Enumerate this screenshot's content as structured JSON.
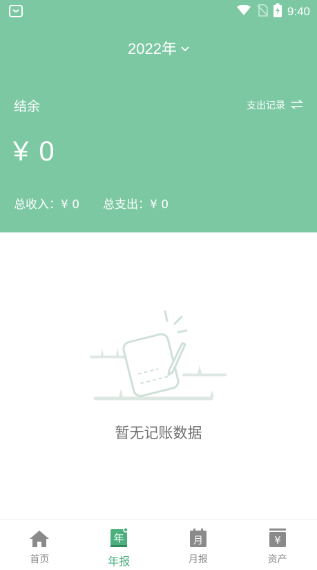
{
  "status_bar": {
    "time": "9:40"
  },
  "header": {
    "year_label": "2022年",
    "balance_label": "结余",
    "records_link_label": "支出记录",
    "balance_amount": "¥ 0",
    "total_income": "总收入：¥ 0",
    "total_expense": "总支出：¥ 0"
  },
  "empty_state": {
    "message": "暂无记账数据"
  },
  "bottom_nav": {
    "items": [
      {
        "label": "首页",
        "icon": "home-icon"
      },
      {
        "label": "年报",
        "icon": "annual-report-icon",
        "active": true
      },
      {
        "label": "月报",
        "icon": "monthly-report-icon"
      },
      {
        "label": "资产",
        "icon": "assets-icon"
      }
    ]
  },
  "colors": {
    "header_green": "#7cc8a3",
    "active_green": "#4caf7d",
    "inactive_gray": "#8a8a8a"
  }
}
